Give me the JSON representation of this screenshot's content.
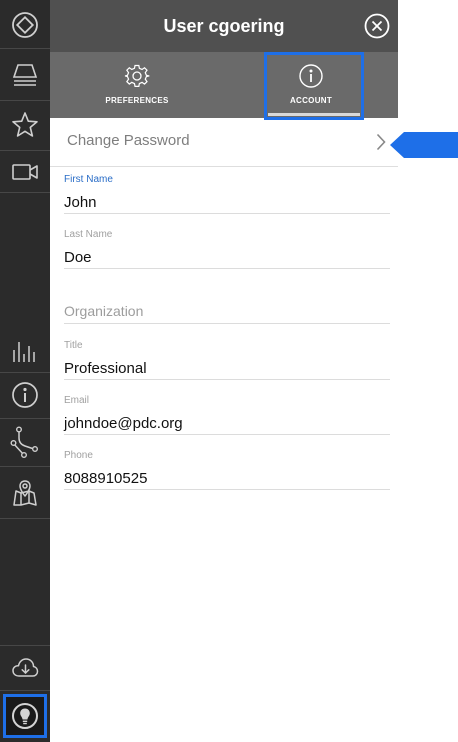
{
  "header": {
    "title": "User cgoering"
  },
  "tabs": [
    {
      "label": "PREFERENCES",
      "icon": "gear-icon"
    },
    {
      "label": "ACCOUNT",
      "icon": "info-icon"
    }
  ],
  "account": {
    "change_password_label": "Change Password",
    "first_name": {
      "label": "First Name",
      "value": "John"
    },
    "last_name": {
      "label": "Last Name",
      "value": "Doe"
    },
    "organization_heading": "Organization",
    "title": {
      "label": "Title",
      "value": "Professional"
    },
    "email": {
      "label": "Email",
      "value": "johndoe@pdc.org"
    },
    "phone": {
      "label": "Phone",
      "value": "8088910525"
    }
  },
  "sidebar": {
    "icons": [
      "home-diamond-icon",
      "layers-icon",
      "star-icon",
      "video-icon",
      "chart-bars-icon",
      "info-icon",
      "network-icon",
      "map-pin-icon",
      "cloud-download-icon",
      "lightbulb-icon"
    ]
  },
  "colors": {
    "accent": "#1e6fe8",
    "sidebar": "#2b2b2b",
    "header": "#505050",
    "tabs": "#6a6a6a",
    "label_active": "#2a6dc7"
  }
}
